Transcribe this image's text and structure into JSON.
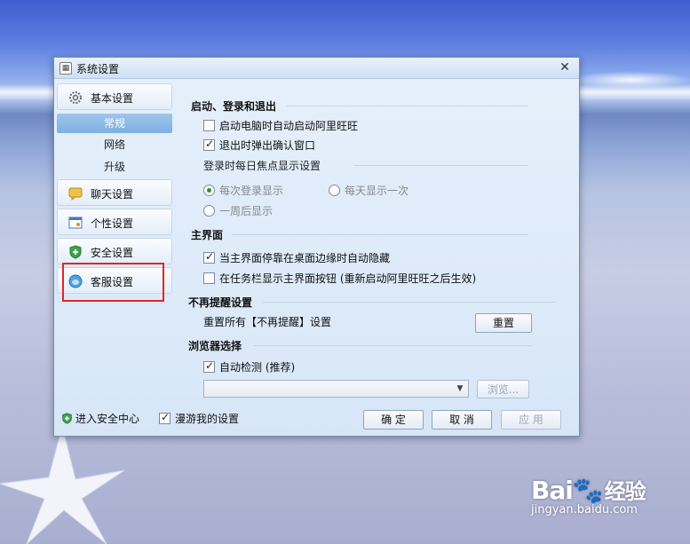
{
  "window": {
    "title": "系统设置"
  },
  "sidebar": {
    "categories": [
      {
        "label": "基本设置",
        "icon": "gear-icon"
      },
      {
        "label": "聊天设置",
        "icon": "chat-icon"
      },
      {
        "label": "个性设置",
        "icon": "personalize-icon"
      },
      {
        "label": "安全设置",
        "icon": "shield-icon"
      },
      {
        "label": "客服设置",
        "icon": "customer-service-icon"
      }
    ],
    "sub_items": [
      "常规",
      "网络",
      "升级"
    ],
    "active_sub": "常规"
  },
  "content": {
    "startup": {
      "title": "启动、登录和退出",
      "auto_start": {
        "label": "启动电脑时自动启动阿里旺旺",
        "checked": false
      },
      "confirm_exit": {
        "label": "退出时弹出确认窗口",
        "checked": true
      },
      "focus_title": "登录时每日焦点显示设置",
      "focus_options": [
        {
          "label": "每次登录显示",
          "checked": true
        },
        {
          "label": "每天显示一次",
          "checked": false
        },
        {
          "label": "一周后显示",
          "checked": false
        }
      ]
    },
    "main_ui": {
      "title": "主界面",
      "auto_hide": {
        "label": "当主界面停靠在桌面边缘时自动隐藏",
        "checked": true
      },
      "taskbar": {
        "label": "在任务栏显示主界面按钮 (重新启动阿里旺旺之后生效)",
        "checked": false
      }
    },
    "reminder": {
      "title": "不再提醒设置",
      "reset_text": "重置所有【不再提醒】设置",
      "reset_button": "重置"
    },
    "browser": {
      "title": "浏览器选择",
      "auto_detect": {
        "label": "自动检测 (推荐)",
        "checked": true
      },
      "select_value": "",
      "browse_button": "浏览..."
    }
  },
  "footer": {
    "security_center": "进入安全中心",
    "roam_settings": {
      "label": "漫游我的设置",
      "checked": true
    },
    "ok": "确 定",
    "cancel": "取 消",
    "apply": "应 用"
  },
  "watermark": {
    "logo": "Bai",
    "logo_cn": "经验",
    "url": "jingyan.baidu.com"
  }
}
